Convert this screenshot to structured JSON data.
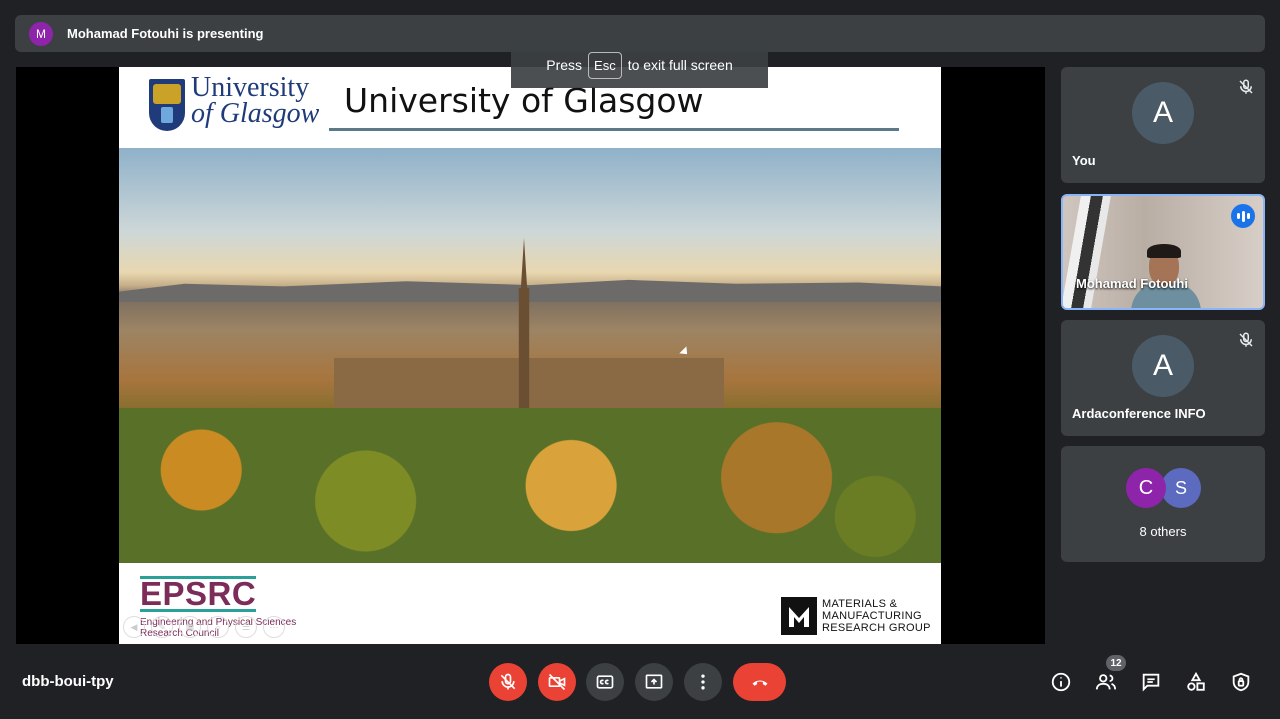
{
  "banner": {
    "avatar_letter": "M",
    "text": "Mohamad Fotouhi is presenting"
  },
  "toast": {
    "prefix": "Press",
    "key": "Esc",
    "suffix": "to exit full screen"
  },
  "slide": {
    "logo_line1": "University",
    "logo_line2": "of Glasgow",
    "title": "University of Glasgow",
    "footer_left_logo": "EPSRC",
    "footer_left_sub1": "Engineering and Physical Sciences",
    "footer_left_sub2": "Research Council",
    "footer_right_line1": "MATERIALS &",
    "footer_right_line2": "MANUFACTURING",
    "footer_right_line3": "RESEARCH GROUP"
  },
  "participants": [
    {
      "avatar": "A",
      "name": "You",
      "muted": true
    },
    {
      "name": "Mohamad Fotouhi",
      "speaking": true
    },
    {
      "avatar": "A",
      "name": "Ardaconference INFO",
      "muted": true
    }
  ],
  "others": {
    "avatar1": "C",
    "avatar2": "S",
    "label": "8 others"
  },
  "footer": {
    "meeting_code": "dbb-boui-tpy",
    "people_count": "12"
  },
  "colors": {
    "accent": "#8ab4f8",
    "danger": "#ea4335",
    "speaking": "#1a73e8",
    "tile": "#3c4043",
    "bg": "#202124"
  }
}
